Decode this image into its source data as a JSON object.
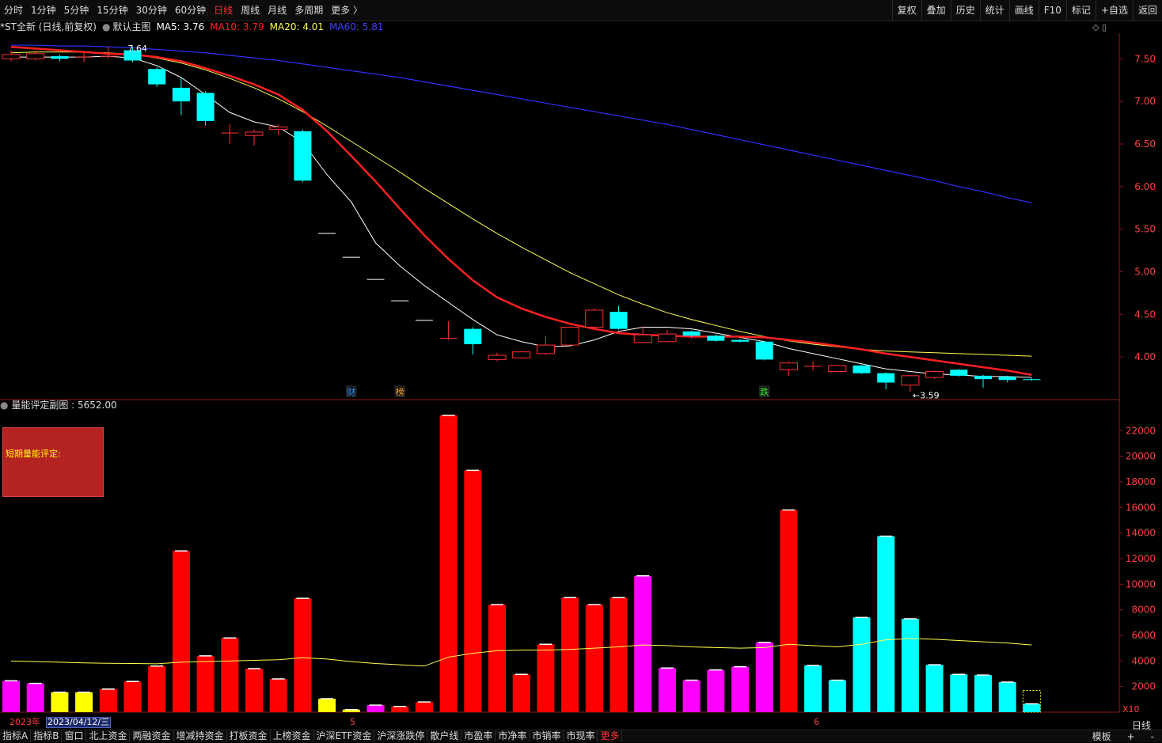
{
  "toolbar_left": [
    "分时",
    "1分钟",
    "5分钟",
    "15分钟",
    "30分钟",
    "60分钟",
    "日线",
    "周线",
    "月线",
    "多周期",
    "更多 〉"
  ],
  "toolbar_active_index": 6,
  "toolbar_right": [
    "复权",
    "叠加",
    "历史",
    "统计",
    "画线",
    "F10",
    "标记",
    "+自选",
    "返回"
  ],
  "main_info": {
    "stock": "*ST全新 (日线,前复权)",
    "template": "默认主图",
    "ma5": "MA5: 3.76",
    "ma10": "MA10: 3.79",
    "ma20": "MA20: 4.01",
    "ma60": "MA60: 5.81"
  },
  "colors": {
    "ma5": "#ffffff",
    "ma10": "#ff2020",
    "ma20": "#ffff50",
    "ma60": "#3030ff",
    "up": "#ff3030",
    "down": "#00ffff"
  },
  "sub_info": "量能评定副图 : 5652.00",
  "red_box_label": "短期量能评定:",
  "price_axis": [
    "7.50",
    "7.00",
    "6.50",
    "6.00",
    "5.50",
    "5.00",
    "4.50",
    "4.00"
  ],
  "volume_axis": [
    "22000",
    "20000",
    "18000",
    "16000",
    "14000",
    "12000",
    "10000",
    "8000",
    "6000",
    "4000",
    "2000"
  ],
  "volume_unit": "X10",
  "markers": [
    {
      "text": "财",
      "color": "#3399ff"
    },
    {
      "text": "榜",
      "color": "#ffaa33"
    },
    {
      "text": "跌",
      "color": "#33ff33"
    }
  ],
  "low_label": "←3.59",
  "high_label": "7.64",
  "date_axis": {
    "year": "2023年",
    "cursor_date": "2023/04/12/三",
    "month1": "5",
    "month2": "6"
  },
  "right_panel_label": "日线",
  "bottom_tabs": [
    "指标A",
    "指标B",
    "窗口",
    "北上资金",
    "两融资金",
    "增减持资金",
    "打板资金",
    "上榜资金",
    "沪深ETF资金",
    "沪深涨跌停",
    "散户线",
    "市盈率",
    "市净率",
    "市销率",
    "市现率",
    "更多"
  ],
  "bottom_right": [
    "模板",
    "+",
    "-"
  ],
  "chart_data": {
    "type": "candlestick",
    "candles": [
      {
        "o": 7.5,
        "c": 7.55,
        "h": 7.6,
        "l": 7.47
      },
      {
        "o": 7.5,
        "c": 7.56,
        "h": 7.6,
        "l": 7.48
      },
      {
        "o": 7.53,
        "c": 7.5,
        "h": 7.55,
        "l": 7.47
      },
      {
        "o": 7.52,
        "c": 7.52,
        "h": 7.58,
        "l": 7.46
      },
      {
        "o": 7.53,
        "c": 7.53,
        "h": 7.64,
        "l": 7.5
      },
      {
        "o": 7.6,
        "c": 7.48,
        "h": 7.64,
        "l": 7.46
      },
      {
        "o": 7.38,
        "c": 7.2,
        "h": 7.4,
        "l": 7.17
      },
      {
        "o": 7.16,
        "c": 7.0,
        "h": 7.27,
        "l": 6.84
      },
      {
        "o": 7.1,
        "c": 6.77,
        "h": 7.12,
        "l": 6.72
      },
      {
        "o": 6.63,
        "c": 6.63,
        "h": 6.73,
        "l": 6.5
      },
      {
        "o": 6.6,
        "c": 6.64,
        "h": 6.67,
        "l": 6.48
      },
      {
        "o": 6.67,
        "c": 6.7,
        "h": 6.73,
        "l": 6.6
      },
      {
        "o": 6.65,
        "c": 6.07,
        "h": 6.67,
        "l": 6.05
      },
      {
        "o": 5.45,
        "c": 5.45,
        "h": 5.45,
        "l": 5.45
      },
      {
        "o": 5.17,
        "c": 5.17,
        "h": 5.17,
        "l": 5.17
      },
      {
        "o": 4.91,
        "c": 4.91,
        "h": 4.91,
        "l": 4.91
      },
      {
        "o": 4.66,
        "c": 4.66,
        "h": 4.66,
        "l": 4.66
      },
      {
        "o": 4.43,
        "c": 4.43,
        "h": 4.43,
        "l": 4.43
      },
      {
        "o": 4.22,
        "c": 4.22,
        "h": 4.42,
        "l": 4.2
      },
      {
        "o": 4.33,
        "c": 4.15,
        "h": 4.35,
        "l": 4.03
      },
      {
        "o": 3.97,
        "c": 4.02,
        "h": 4.05,
        "l": 3.95
      },
      {
        "o": 3.99,
        "c": 4.06,
        "h": 4.07,
        "l": 3.98
      },
      {
        "o": 4.04,
        "c": 4.14,
        "h": 4.25,
        "l": 4.02
      },
      {
        "o": 4.14,
        "c": 4.35,
        "h": 4.36,
        "l": 4.14
      },
      {
        "o": 4.35,
        "c": 4.55,
        "h": 4.57,
        "l": 4.34
      },
      {
        "o": 4.53,
        "c": 4.33,
        "h": 4.6,
        "l": 4.32
      },
      {
        "o": 4.17,
        "c": 4.26,
        "h": 4.36,
        "l": 4.16
      },
      {
        "o": 4.18,
        "c": 4.27,
        "h": 4.32,
        "l": 4.17
      },
      {
        "o": 4.3,
        "c": 4.25,
        "h": 4.31,
        "l": 4.23
      },
      {
        "o": 4.25,
        "c": 4.19,
        "h": 4.26,
        "l": 4.18
      },
      {
        "o": 4.2,
        "c": 4.18,
        "h": 4.21,
        "l": 4.17
      },
      {
        "o": 4.18,
        "c": 3.97,
        "h": 4.19,
        "l": 3.96
      },
      {
        "o": 3.85,
        "c": 3.93,
        "h": 3.95,
        "l": 3.78
      },
      {
        "o": 3.89,
        "c": 3.89,
        "h": 3.95,
        "l": 3.84
      },
      {
        "o": 3.83,
        "c": 3.9,
        "h": 3.91,
        "l": 3.82
      },
      {
        "o": 3.9,
        "c": 3.81,
        "h": 3.91,
        "l": 3.8
      },
      {
        "o": 3.81,
        "c": 3.7,
        "h": 3.82,
        "l": 3.62
      },
      {
        "o": 3.67,
        "c": 3.78,
        "h": 3.79,
        "l": 3.59
      },
      {
        "o": 3.76,
        "c": 3.83,
        "h": 3.84,
        "l": 3.74
      },
      {
        "o": 3.85,
        "c": 3.78,
        "h": 3.86,
        "l": 3.77
      },
      {
        "o": 3.78,
        "c": 3.74,
        "h": 3.79,
        "l": 3.64
      },
      {
        "o": 3.77,
        "c": 3.73,
        "h": 3.78,
        "l": 3.7
      },
      {
        "o": 3.74,
        "c": 3.73,
        "h": 3.75,
        "l": 3.72
      }
    ],
    "ma5": [
      7.52,
      7.52,
      7.52,
      7.52,
      7.53,
      7.51,
      7.42,
      7.28,
      7.08,
      6.87,
      6.76,
      6.7,
      6.52,
      6.14,
      5.82,
      5.34,
      5.07,
      4.84,
      4.64,
      4.44,
      4.26,
      4.18,
      4.12,
      4.13,
      4.2,
      4.3,
      4.35,
      4.35,
      4.33,
      4.28,
      4.23,
      4.18,
      4.1,
      4.04,
      3.98,
      3.92,
      3.86,
      3.83,
      3.8,
      3.79,
      3.77,
      3.77,
      3.76
    ],
    "ma10": [
      7.64,
      7.62,
      7.6,
      7.58,
      7.56,
      7.55,
      7.52,
      7.47,
      7.39,
      7.3,
      7.2,
      7.08,
      6.9,
      6.65,
      6.36,
      6.06,
      5.74,
      5.43,
      5.15,
      4.9,
      4.7,
      4.57,
      4.47,
      4.39,
      4.33,
      4.28,
      4.26,
      4.25,
      4.24,
      4.24,
      4.24,
      4.23,
      4.2,
      4.17,
      4.13,
      4.09,
      4.04,
      4.0,
      3.96,
      3.92,
      3.88,
      3.84,
      3.79
    ],
    "ma20": [
      7.57,
      7.58,
      7.58,
      7.58,
      7.57,
      7.55,
      7.51,
      7.45,
      7.37,
      7.27,
      7.16,
      7.03,
      6.88,
      6.71,
      6.53,
      6.35,
      6.17,
      5.98,
      5.8,
      5.62,
      5.45,
      5.29,
      5.14,
      4.99,
      4.86,
      4.73,
      4.62,
      4.52,
      4.44,
      4.37,
      4.3,
      4.24,
      4.19,
      4.15,
      4.12,
      4.09,
      4.07,
      4.06,
      4.05,
      4.04,
      4.03,
      4.02,
      4.01
    ],
    "ma60": [
      7.66,
      7.66,
      7.65,
      7.65,
      7.64,
      7.63,
      7.61,
      7.59,
      7.57,
      7.54,
      7.51,
      7.48,
      7.44,
      7.4,
      7.36,
      7.32,
      7.28,
      7.23,
      7.18,
      7.13,
      7.08,
      7.03,
      6.98,
      6.93,
      6.88,
      6.83,
      6.78,
      6.73,
      6.67,
      6.61,
      6.55,
      6.49,
      6.43,
      6.37,
      6.31,
      6.25,
      6.19,
      6.13,
      6.07,
      6.0,
      5.94,
      5.87,
      5.81
    ],
    "volume": [
      2450,
      2250,
      1550,
      1550,
      1800,
      2400,
      3600,
      12600,
      4400,
      5800,
      3400,
      2600,
      8900,
      1050,
      200,
      550,
      450,
      800,
      23200,
      18900,
      8400,
      2950,
      5300,
      8950,
      8400,
      8950,
      10650,
      3450,
      2500,
      3300,
      3550,
      5450,
      15800,
      3650,
      2500,
      7400,
      13750,
      7300,
      3700,
      2950,
      2900,
      2350,
      650
    ],
    "volume_colors": [
      "m",
      "m",
      "y",
      "y",
      "r",
      "r",
      "r",
      "r",
      "r",
      "r",
      "r",
      "r",
      "r",
      "y",
      "y",
      "m",
      "r",
      "r",
      "r",
      "r",
      "r",
      "r",
      "r",
      "r",
      "r",
      "r",
      "m",
      "m",
      "m",
      "m",
      "m",
      "m",
      "r",
      "c",
      "c",
      "c",
      "c",
      "c",
      "c",
      "c",
      "c",
      "c",
      "c"
    ],
    "volume_ma": [
      4000,
      3950,
      3900,
      3850,
      3820,
      3800,
      3780,
      3900,
      3950,
      4000,
      4050,
      4100,
      4250,
      4150,
      3950,
      3800,
      3700,
      3600,
      4300,
      4600,
      4800,
      4850,
      4850,
      4900,
      5000,
      5100,
      5250,
      5200,
      5100,
      5050,
      5000,
      5050,
      5300,
      5200,
      5100,
      5300,
      5650,
      5750,
      5700,
      5600,
      5500,
      5400,
      5250
    ],
    "price_range": [
      3.5,
      7.8
    ],
    "volume_range": [
      0,
      23500
    ]
  }
}
